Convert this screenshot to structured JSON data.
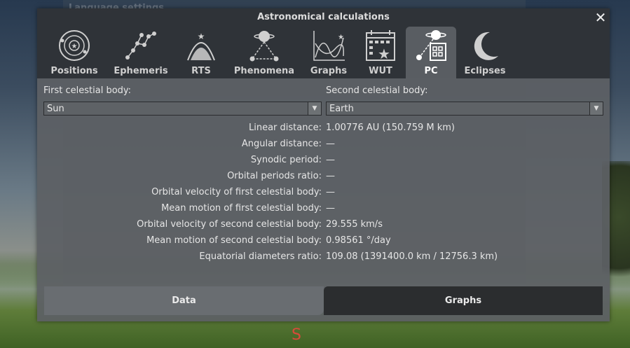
{
  "background": {
    "ghost_title": "Language settings",
    "compass_label": "S"
  },
  "dialog": {
    "title": "Astronomical calculations",
    "close_glyph": "✕"
  },
  "tabs": [
    {
      "label": "Positions",
      "icon": "orbit-icon"
    },
    {
      "label": "Ephemeris",
      "icon": "constellation-icon"
    },
    {
      "label": "RTS",
      "icon": "rise-transit-set-icon"
    },
    {
      "label": "Phenomena",
      "icon": "planet-phenomena-icon"
    },
    {
      "label": "Graphs",
      "icon": "graph-icon"
    },
    {
      "label": "WUT",
      "icon": "calendar-star-icon"
    },
    {
      "label": "PC",
      "icon": "planet-calculator-icon",
      "active": true
    },
    {
      "label": "Eclipses",
      "icon": "crescent-moon-icon"
    }
  ],
  "first_body": {
    "label": "First celestial body:",
    "value": "Sun"
  },
  "second_body": {
    "label": "Second celestial body:",
    "value": "Earth"
  },
  "results": [
    {
      "key": "Linear distance:",
      "value": "1.00776 AU (150.759 M km)"
    },
    {
      "key": "Angular distance:",
      "value": "—"
    },
    {
      "key": "Synodic period:",
      "value": "—"
    },
    {
      "key": "Orbital periods ratio:",
      "value": "—"
    },
    {
      "key": "Orbital velocity of first celestial body:",
      "value": "—"
    },
    {
      "key": "Mean motion of first celestial body:",
      "value": "—"
    },
    {
      "key": "Orbital velocity of second celestial body:",
      "value": "29.555 km/s"
    },
    {
      "key": "Mean motion of second celestial body:",
      "value": "0.98561 °/day"
    },
    {
      "key": "Equatorial diameters ratio:",
      "value": "109.08 (1391400.0 km / 12756.3 km)"
    }
  ],
  "buttons": {
    "data": "Data",
    "graphs": "Graphs"
  },
  "colors": {
    "accent": "#ffffff",
    "compass": "#d84a3a"
  }
}
